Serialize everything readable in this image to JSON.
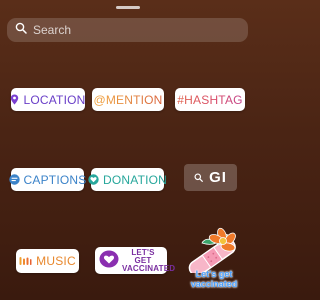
{
  "search": {
    "placeholder": "Search"
  },
  "stickers": {
    "location": {
      "label": "LOCATION",
      "icon": "location-pin-icon",
      "color": "#6a3fc8"
    },
    "mention": {
      "label": "@MENTION"
    },
    "hashtag": {
      "label": "#HASHTAG"
    },
    "captions": {
      "label": "CAPTIONS",
      "icon": "captions-icon",
      "color": "#3b83c9"
    },
    "donation": {
      "label": "DONATION",
      "icon": "heart-icon",
      "color": "#27a79c"
    },
    "gif": {
      "label": "GI",
      "icon": "search-icon"
    },
    "music": {
      "label": "MUSIC",
      "icon": "music-bars-icon",
      "color": "#e8882e"
    },
    "vaccine": {
      "label": "LET'S GET VACCINATED",
      "icon": "heart-badge-icon",
      "color": "#7a2fa0"
    },
    "bandaid": {
      "label": "Let's get vaccinated",
      "icon": "bandaid-flower-icon"
    }
  }
}
